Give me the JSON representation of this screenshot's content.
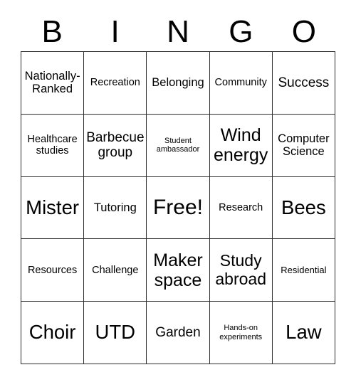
{
  "card": {
    "title": "BINGO card",
    "columns": [
      "B",
      "I",
      "N",
      "G",
      "O"
    ],
    "grid_size": "5x5",
    "text_color": "#000000",
    "border_color": "#2b2b2b",
    "background_color": "#ffffff",
    "header": {
      "letters": [
        {
          "label": "B"
        },
        {
          "label": "I"
        },
        {
          "label": "N"
        },
        {
          "label": "G"
        },
        {
          "label": "O"
        }
      ]
    },
    "rows": [
      {
        "cells": [
          {
            "text": "Nationally-\nRanked",
            "size": "fs-lg",
            "free": false
          },
          {
            "text": "Recreation",
            "size": "fs-md",
            "free": false
          },
          {
            "text": "Belonging",
            "size": "fs-lg",
            "free": false
          },
          {
            "text": "Community",
            "size": "fs-md",
            "free": false
          },
          {
            "text": "Success",
            "size": "fs-xl",
            "free": false
          }
        ]
      },
      {
        "cells": [
          {
            "text": "Healthcare\nstudies",
            "size": "fs-md",
            "free": false
          },
          {
            "text": "Barbecue\ngroup",
            "size": "fs-xl",
            "free": false
          },
          {
            "text": "Student\nambassador",
            "size": "fs-xs",
            "free": false
          },
          {
            "text": "Wind\nenergy",
            "size": "fs-3xl",
            "free": false
          },
          {
            "text": "Computer\nScience",
            "size": "fs-lg",
            "free": false
          }
        ]
      },
      {
        "cells": [
          {
            "text": "Mister",
            "size": "fs-4xl",
            "free": false
          },
          {
            "text": "Tutoring",
            "size": "fs-lg",
            "free": false
          },
          {
            "text": "Free!",
            "size": "fs-5xl",
            "free": true
          },
          {
            "text": "Research",
            "size": "fs-md",
            "free": false
          },
          {
            "text": "Bees",
            "size": "fs-4xl",
            "free": false
          }
        ]
      },
      {
        "cells": [
          {
            "text": "Resources",
            "size": "fs-md",
            "free": false
          },
          {
            "text": "Challenge",
            "size": "fs-md",
            "free": false
          },
          {
            "text": "Maker\nspace",
            "size": "fs-3xl",
            "free": false
          },
          {
            "text": "Study\nabroad",
            "size": "fs-2xl",
            "free": false
          },
          {
            "text": "Residential",
            "size": "fs-sm",
            "free": false
          }
        ]
      },
      {
        "cells": [
          {
            "text": "Choir",
            "size": "fs-4xl",
            "free": false
          },
          {
            "text": "UTD",
            "size": "fs-4xl",
            "free": false
          },
          {
            "text": "Garden",
            "size": "fs-xl",
            "free": false
          },
          {
            "text": "Hands-on\nexperiments",
            "size": "fs-xs",
            "free": false
          },
          {
            "text": "Law",
            "size": "fs-4xl",
            "free": false
          }
        ]
      }
    ]
  }
}
